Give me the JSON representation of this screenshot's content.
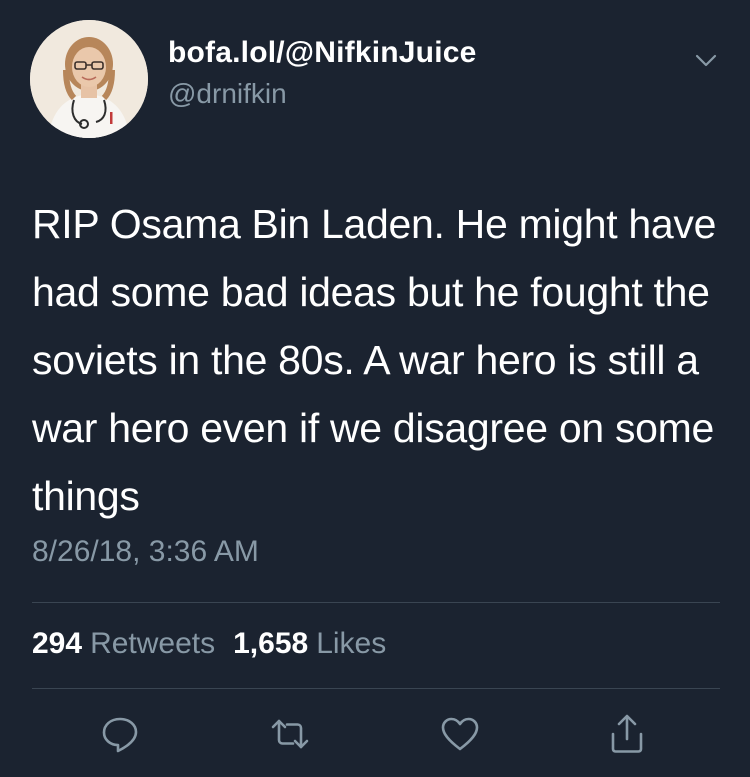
{
  "user": {
    "display_name": "bofa.lol/@NifkinJuice",
    "handle": "@drnifkin",
    "avatar_icon": "profile-photo"
  },
  "tweet": {
    "text": "RIP Osama Bin Laden. He might have had some bad ideas but he fought the soviets in the 80s. A war hero is still a war hero even if we disagree on some things",
    "timestamp": "8/26/18, 3:36 AM"
  },
  "stats": {
    "retweets_count": "294",
    "retweets_label": "Retweets",
    "likes_count": "1,658",
    "likes_label": "Likes"
  },
  "actions": {
    "reply_icon": "reply-icon",
    "retweet_icon": "retweet-icon",
    "like_icon": "heart-icon",
    "share_icon": "share-icon",
    "menu_icon": "chevron-down-icon"
  },
  "colors": {
    "background": "#1b2330",
    "secondary_text": "#8899a6",
    "divider": "#3a4552"
  }
}
